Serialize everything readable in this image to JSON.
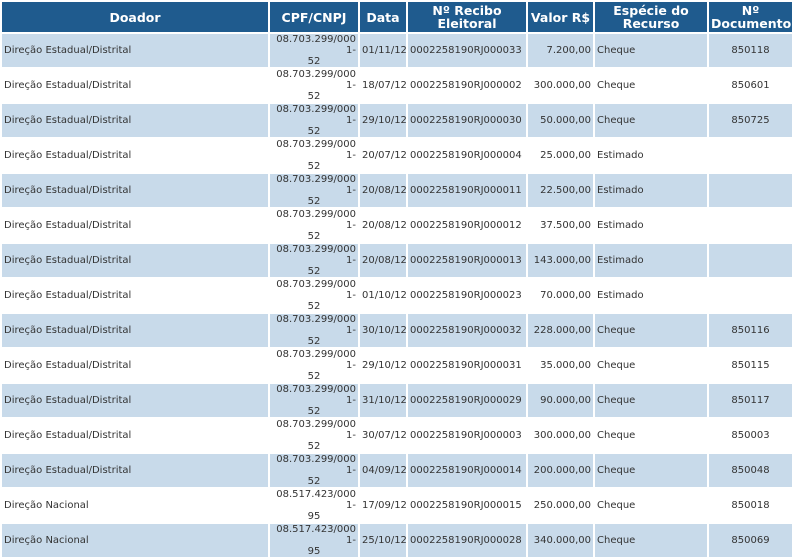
{
  "table": {
    "headers": {
      "doador": "Doador",
      "cpf": "CPF/CNPJ",
      "data": "Data",
      "recibo": "Nº Recibo Eleitoral",
      "valor": "Valor R$",
      "especie": "Espécie do Recurso",
      "documento": "Nº Documento"
    },
    "rows": [
      {
        "doador": "Direção Estadual/Distrital",
        "cpf1": "08.703.299/0001-",
        "cpf2": "52",
        "data": "01/11/12",
        "recibo": "0002258190RJ000033",
        "valor": "7.200,00",
        "especie": "Cheque",
        "documento": "850118"
      },
      {
        "doador": "Direção Estadual/Distrital",
        "cpf1": "08.703.299/0001-",
        "cpf2": "52",
        "data": "18/07/12",
        "recibo": "0002258190RJ000002",
        "valor": "300.000,00",
        "especie": "Cheque",
        "documento": "850601"
      },
      {
        "doador": "Direção Estadual/Distrital",
        "cpf1": "08.703.299/0001-",
        "cpf2": "52",
        "data": "29/10/12",
        "recibo": "0002258190RJ000030",
        "valor": "50.000,00",
        "especie": "Cheque",
        "documento": "850725"
      },
      {
        "doador": "Direção Estadual/Distrital",
        "cpf1": "08.703.299/0001-",
        "cpf2": "52",
        "data": "20/07/12",
        "recibo": "0002258190RJ000004",
        "valor": "25.000,00",
        "especie": "Estimado",
        "documento": ""
      },
      {
        "doador": "Direção Estadual/Distrital",
        "cpf1": "08.703.299/0001-",
        "cpf2": "52",
        "data": "20/08/12",
        "recibo": "0002258190RJ000011",
        "valor": "22.500,00",
        "especie": "Estimado",
        "documento": ""
      },
      {
        "doador": "Direção Estadual/Distrital",
        "cpf1": "08.703.299/0001-",
        "cpf2": "52",
        "data": "20/08/12",
        "recibo": "0002258190RJ000012",
        "valor": "37.500,00",
        "especie": "Estimado",
        "documento": ""
      },
      {
        "doador": "Direção Estadual/Distrital",
        "cpf1": "08.703.299/0001-",
        "cpf2": "52",
        "data": "20/08/12",
        "recibo": "0002258190RJ000013",
        "valor": "143.000,00",
        "especie": "Estimado",
        "documento": ""
      },
      {
        "doador": "Direção Estadual/Distrital",
        "cpf1": "08.703.299/0001-",
        "cpf2": "52",
        "data": "01/10/12",
        "recibo": "0002258190RJ000023",
        "valor": "70.000,00",
        "especie": "Estimado",
        "documento": ""
      },
      {
        "doador": "Direção Estadual/Distrital",
        "cpf1": "08.703.299/0001-",
        "cpf2": "52",
        "data": "30/10/12",
        "recibo": "0002258190RJ000032",
        "valor": "228.000,00",
        "especie": "Cheque",
        "documento": "850116"
      },
      {
        "doador": "Direção Estadual/Distrital",
        "cpf1": "08.703.299/0001-",
        "cpf2": "52",
        "data": "29/10/12",
        "recibo": "0002258190RJ000031",
        "valor": "35.000,00",
        "especie": "Cheque",
        "documento": "850115"
      },
      {
        "doador": "Direção Estadual/Distrital",
        "cpf1": "08.703.299/0001-",
        "cpf2": "52",
        "data": "31/10/12",
        "recibo": "0002258190RJ000029",
        "valor": "90.000,00",
        "especie": "Cheque",
        "documento": "850117"
      },
      {
        "doador": "Direção Estadual/Distrital",
        "cpf1": "08.703.299/0001-",
        "cpf2": "52",
        "data": "30/07/12",
        "recibo": "0002258190RJ000003",
        "valor": "300.000,00",
        "especie": "Cheque",
        "documento": "850003"
      },
      {
        "doador": "Direção Estadual/Distrital",
        "cpf1": "08.703.299/0001-",
        "cpf2": "52",
        "data": "04/09/12",
        "recibo": "0002258190RJ000014",
        "valor": "200.000,00",
        "especie": "Cheque",
        "documento": "850048"
      },
      {
        "doador": "Direção Nacional",
        "cpf1": "08.517.423/0001-",
        "cpf2": "95",
        "data": "17/09/12",
        "recibo": "0002258190RJ000015",
        "valor": "250.000,00",
        "especie": "Cheque",
        "documento": "850018"
      },
      {
        "doador": "Direção Nacional",
        "cpf1": "08.517.423/0001-",
        "cpf2": "95",
        "data": "25/10/12",
        "recibo": "0002258190RJ000028",
        "valor": "340.000,00",
        "especie": "Cheque",
        "documento": "850069"
      }
    ]
  },
  "colors": {
    "header_bg": "#1f5b8e",
    "row_alt_bg": "#c8daea",
    "row_bg": "#ffffff"
  }
}
